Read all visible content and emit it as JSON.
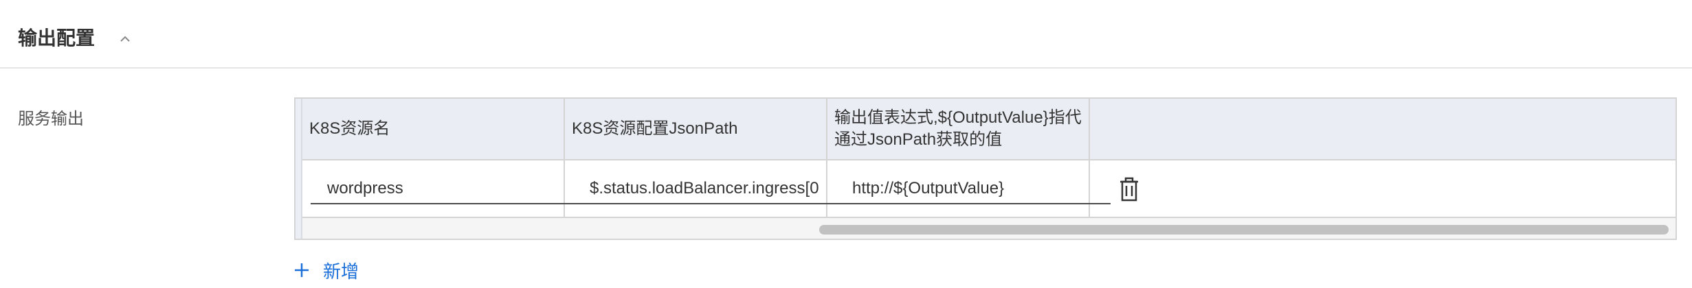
{
  "section": {
    "title": "输出配置",
    "collapse_icon": "chevron-up-icon"
  },
  "field": {
    "label": "服务输出"
  },
  "table": {
    "columns": [
      "K8S资源名",
      "K8S资源配置JsonPath",
      "输出值表达式,${OutputValue}指代通过JsonPath获取的值",
      ""
    ],
    "rows": [
      {
        "resource_name": "wordpress",
        "json_path": "$.status.loadBalancer.ingress[0",
        "output_expression": "http://${OutputValue}",
        "action_icon": "trash-icon"
      }
    ]
  },
  "add": {
    "label": "新增",
    "icon": "plus-icon"
  },
  "colors": {
    "accent": "#1a6fd8",
    "header_bg": "#eaeef4",
    "border": "#d4d4d4"
  }
}
